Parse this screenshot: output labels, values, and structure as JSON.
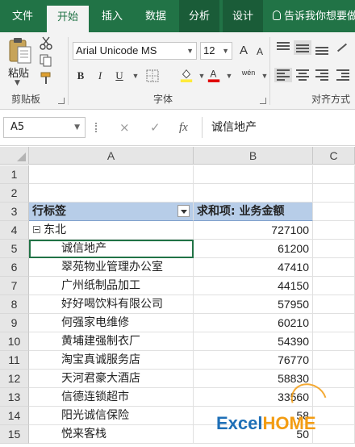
{
  "ribbon": {
    "tabs": [
      {
        "label": "文件"
      },
      {
        "label": "开始"
      },
      {
        "label": "插入"
      },
      {
        "label": "数据"
      },
      {
        "label": "分析"
      },
      {
        "label": "设计"
      }
    ],
    "tell_me": "告诉我你想要做",
    "clipboard": {
      "paste_label": "粘贴",
      "group_label": "剪贴板"
    },
    "font": {
      "family": "Arial Unicode MS",
      "size": "12",
      "group_label": "字体",
      "bold": "B",
      "italic": "I",
      "underline": "U",
      "phonetic": "wén"
    },
    "alignment": {
      "group_label": "对齐方式"
    },
    "colors": {
      "brand": "#217346",
      "fill_accent": "#ffeb3b",
      "font_accent": "#e00000"
    }
  },
  "formula_bar": {
    "name_box": "A5",
    "cancel_icon": "×",
    "enter_icon": "✓",
    "fx_label": "fx",
    "content": "诚信地产"
  },
  "grid": {
    "columns": [
      "A",
      "B",
      "C"
    ],
    "rows": [
      "1",
      "2",
      "3",
      "4",
      "5",
      "6",
      "7",
      "8",
      "9",
      "10",
      "11",
      "12",
      "13",
      "14",
      "15"
    ],
    "header": {
      "row_labels": "行标签",
      "sum_field": "求和项: 业务金额"
    },
    "group": {
      "name": "东北",
      "total": "727100"
    },
    "items": [
      {
        "label": "诚信地产",
        "value": "61200"
      },
      {
        "label": "翠苑物业管理办公室",
        "value": "47410"
      },
      {
        "label": "广州纸制品加工",
        "value": "44150"
      },
      {
        "label": "好好喝饮料有限公司",
        "value": "57950"
      },
      {
        "label": "何强家电维修",
        "value": "60210"
      },
      {
        "label": "黄埔建强制衣厂",
        "value": "54390"
      },
      {
        "label": "淘宝真诚服务店",
        "value": "76770"
      },
      {
        "label": "天河君豪大酒店",
        "value": "58830"
      },
      {
        "label": "信德连锁超市",
        "value": "33560"
      },
      {
        "label": "阳光诚信保险",
        "value": "58"
      },
      {
        "label": "悦来客栈",
        "value": "50"
      }
    ]
  },
  "watermark": {
    "part1": "Excel",
    "part2": "HOME"
  }
}
